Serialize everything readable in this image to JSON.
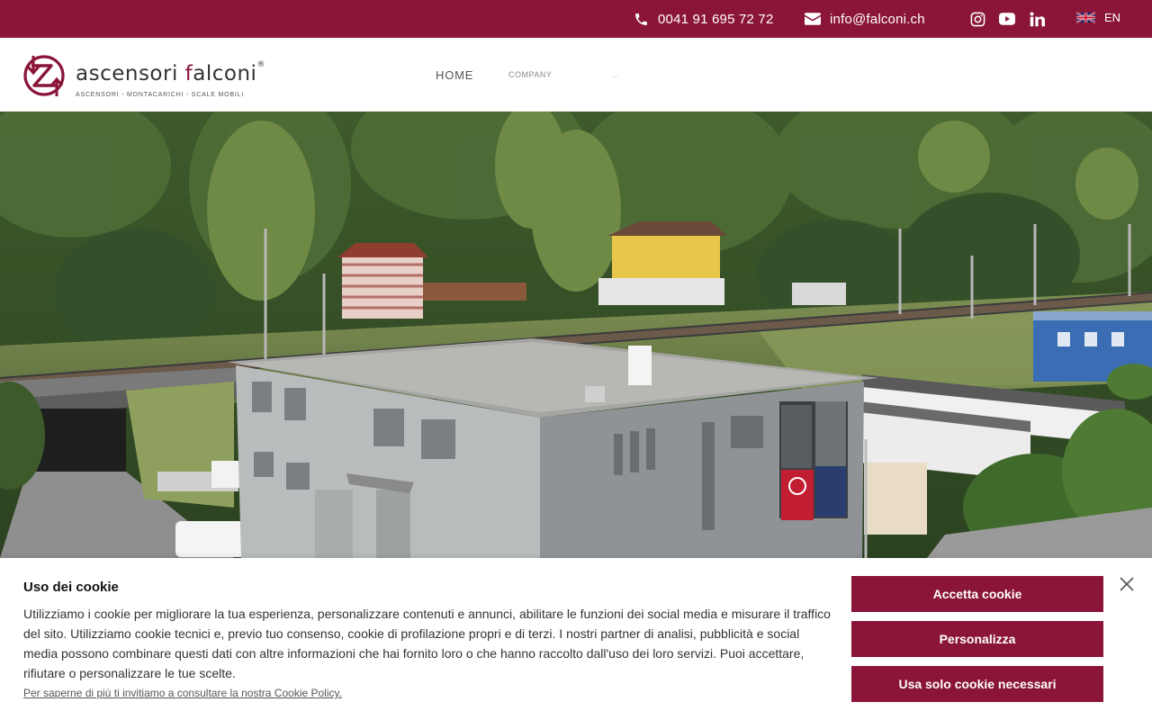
{
  "topbar": {
    "phone": "0041 91 695 72 72",
    "email": "info@falconi.ch",
    "social": [
      "instagram-icon",
      "youtube-icon",
      "linkedin-icon"
    ],
    "language": "EN",
    "background": "#8a1538"
  },
  "header": {
    "brand_part1": "ascensori ",
    "brand_initial": "f",
    "brand_part2": "alconi",
    "registered": "®",
    "tagline": "ASCENSORI - MONTACARICHI - SCALE MOBILI",
    "nav": [
      {
        "label": "HOME"
      },
      {
        "label": "COMPANY"
      },
      {
        "label": "..."
      }
    ]
  },
  "cookie": {
    "title": "Uso dei cookie",
    "text": "Utilizziamo i cookie per migliorare la tua esperienza, personalizzare contenuti e annunci, abilitare le funzioni dei social media e misurare il traffico del sito. Utilizziamo cookie tecnici e, previo tuo consenso, cookie di profilazione propri e di terzi. I nostri partner di analisi, pubblicità e social media possono combinare questi dati con altre informazioni che hai fornito loro o che hanno raccolto dall'uso dei loro servizi. Puoi accettare, rifiutare o personalizzare le tue scelte.",
    "policy_link": "Per saperne di più ti invitiamo a consultare la nostra Cookie Policy.",
    "accept_label": "Accetta cookie",
    "customize_label": "Personalizza",
    "necessary_label": "Usa solo cookie necessari"
  },
  "colors": {
    "accent": "#8a1538"
  }
}
